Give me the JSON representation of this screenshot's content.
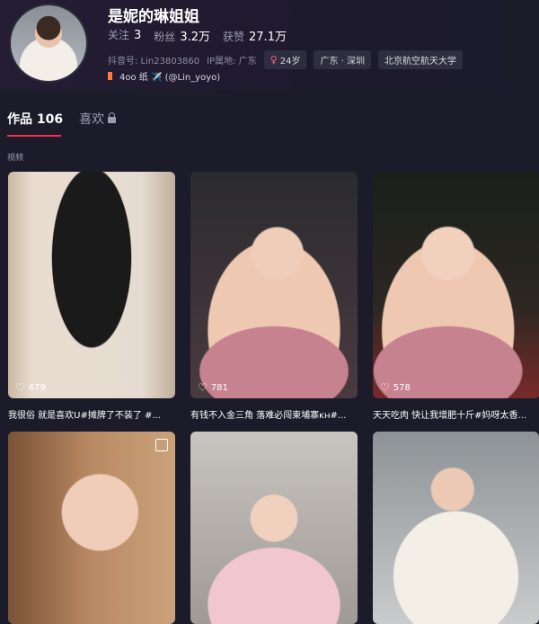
{
  "profile": {
    "name": "是妮的琳姐姐",
    "following_label": "关注",
    "following": "3",
    "followers_label": "粉丝",
    "followers": "3.2万",
    "likes_label": "获赞",
    "likes": "27.1万",
    "douyin_id": "抖音号: Lin23803860",
    "ip": "IP属地: 广东",
    "age_tag": "24岁",
    "location_tag": "广东 · 深圳",
    "school_tag": "北京航空航天大学",
    "bio_text": "4oo 纸 ✈️ (@Lin_yoyo)"
  },
  "tabs": [
    {
      "label": "作品 106",
      "active": true
    },
    {
      "label": "喜欢",
      "active": false
    }
  ],
  "section_label": "视频",
  "videos": [
    {
      "likes": "679",
      "caption": "我很俗 就是喜欢U#摊牌了不装了 #..."
    },
    {
      "likes": "781",
      "caption": "有钱不入金三角 落难必闯柬埔寨ᴋʜ#..."
    },
    {
      "likes": "578",
      "caption": "天天吃肉 快让我增肥十斤#妈呀太香..."
    },
    {
      "likes": "",
      "caption": ""
    },
    {
      "likes": "",
      "caption": ""
    },
    {
      "likes": "",
      "caption": ""
    }
  ],
  "colors": {
    "accent": "#fe2c55",
    "background": "#1b1b2a"
  }
}
